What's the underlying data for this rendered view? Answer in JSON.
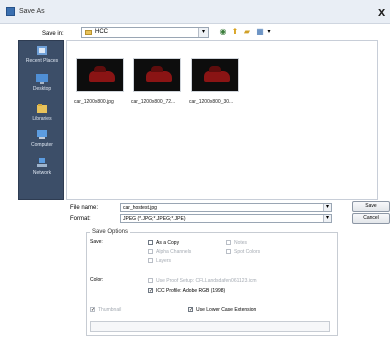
{
  "window": {
    "title": "Save As",
    "close_glyph": "x"
  },
  "save_in": {
    "label": "Save in:",
    "value": "HCC"
  },
  "places": [
    {
      "label": "Recent Places",
      "icon": "recent-places-icon"
    },
    {
      "label": "Desktop",
      "icon": "desktop-icon"
    },
    {
      "label": "Libraries",
      "icon": "libraries-icon"
    },
    {
      "label": "Computer",
      "icon": "computer-icon"
    },
    {
      "label": "Network",
      "icon": "network-icon"
    }
  ],
  "files": [
    {
      "name": "car_1200x800.jpg"
    },
    {
      "name": "car_1200x800_72..."
    },
    {
      "name": "car_1200x800_30..."
    }
  ],
  "file_name": {
    "label": "File name:",
    "value": "car_hostest.jpg"
  },
  "format": {
    "label": "Format:",
    "value": "JPEG (*.JPG;*.JPEG;*.JPE)"
  },
  "buttons": {
    "save": "Save",
    "cancel": "Cancel"
  },
  "save_options": {
    "title": "Save Options",
    "save_label": "Save:",
    "as_copy": "As a Copy",
    "alpha_channels": "Alpha Channels",
    "layers": "Layers",
    "notes": "Notes",
    "spot_colors": "Spot Colors"
  },
  "color": {
    "label": "Color:",
    "use_proof": "Use Proof Setup:  CFLLandsdafen061123.icm",
    "icc_profile": "ICC Profile:  Adobe RGB (1998)"
  },
  "thumbnail": "Thumbnail",
  "lower_case": "Use Lower Case Extension",
  "colors": {
    "sidebar": "#3c4e68",
    "car": "#8a1414"
  }
}
